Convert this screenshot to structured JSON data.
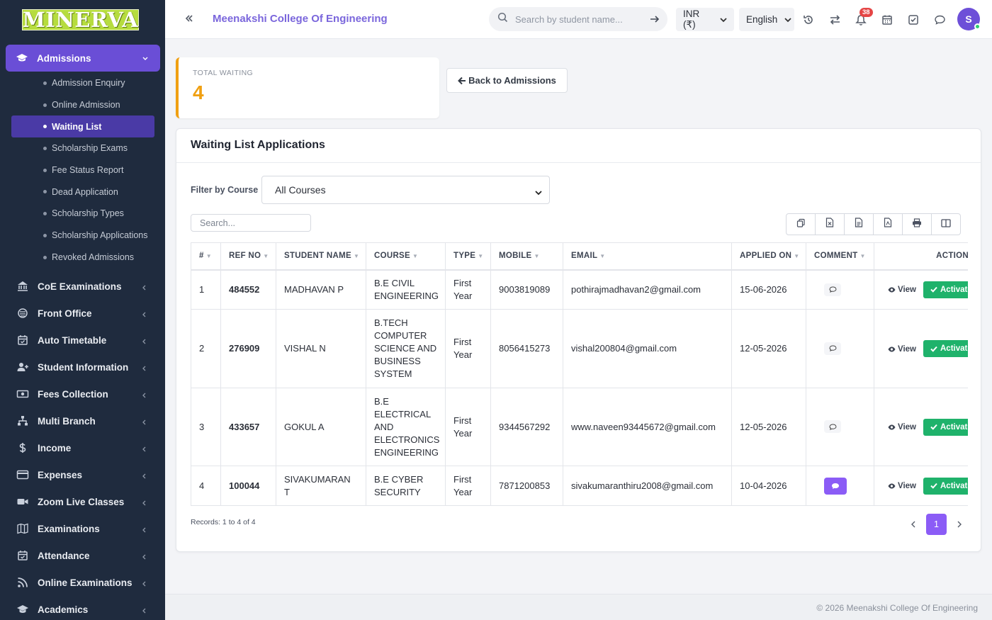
{
  "brand": {
    "logo_text": "MINERVA"
  },
  "sidebar": {
    "active_section": "Admissions",
    "admissions_items": [
      {
        "label": "Admission Enquiry"
      },
      {
        "label": "Online Admission"
      },
      {
        "label": "Waiting List",
        "active": true
      },
      {
        "label": "Scholarship Exams"
      },
      {
        "label": "Fee Status Report"
      },
      {
        "label": "Dead Application"
      },
      {
        "label": "Scholarship Types"
      },
      {
        "label": "Scholarship Applications"
      },
      {
        "label": "Revoked Admissions"
      }
    ],
    "sections": [
      {
        "label": "CoE Examinations",
        "icon": "bank-icon"
      },
      {
        "label": "Front Office",
        "icon": "front-office-icon"
      },
      {
        "label": "Auto Timetable",
        "icon": "calendar-check-icon"
      },
      {
        "label": "Student Information",
        "icon": "user-plus-icon"
      },
      {
        "label": "Fees Collection",
        "icon": "money-icon"
      },
      {
        "label": "Multi Branch",
        "icon": "sitemap-icon"
      },
      {
        "label": "Income",
        "icon": "dollar-icon"
      },
      {
        "label": "Expenses",
        "icon": "credit-card-icon"
      },
      {
        "label": "Zoom Live Classes",
        "icon": "video-icon"
      },
      {
        "label": "Examinations",
        "icon": "map-icon"
      },
      {
        "label": "Attendance",
        "icon": "calendar-check-icon"
      },
      {
        "label": "Online Examinations",
        "icon": "rss-icon"
      },
      {
        "label": "Academics",
        "icon": "graduation-cap-icon"
      }
    ]
  },
  "header": {
    "college_name": "Meenakshi College Of Engineering",
    "search_placeholder": "Search by student name...",
    "currency": "INR (₹)",
    "language": "English",
    "notification_count": "38",
    "avatar_initial": "S"
  },
  "stat": {
    "label": "TOTAL WAITING",
    "value": "4",
    "accent": "#f0a012"
  },
  "back_button": "Back to Admissions",
  "card": {
    "title": "Waiting List Applications",
    "filter_label": "Filter by Course",
    "filter_value": "All Courses",
    "search_placeholder": "Search...",
    "export_buttons": [
      "copy-icon",
      "excel-icon",
      "csv-icon",
      "pdf-icon",
      "print-icon",
      "columns-icon"
    ]
  },
  "table": {
    "columns": [
      "#",
      "REF NO",
      "STUDENT NAME",
      "COURSE",
      "TYPE",
      "MOBILE",
      "EMAIL",
      "APPLIED ON",
      "COMMENT",
      "ACTION"
    ],
    "rows": [
      {
        "no": "1",
        "ref": "484552",
        "name": "MADHAVAN P",
        "course": "B.E CIVIL ENGINEERING",
        "type": "First Year",
        "mobile": "9003819089",
        "email": "pothirajmadhavan2@gmail.com",
        "applied": "15-06-2026",
        "has_comment": false
      },
      {
        "no": "2",
        "ref": "276909",
        "name": "VISHAL N",
        "course": "B.TECH COMPUTER SCIENCE AND BUSINESS SYSTEM",
        "type": "First Year",
        "mobile": "8056415273",
        "email": "vishal200804@gmail.com",
        "applied": "12-05-2026",
        "has_comment": false
      },
      {
        "no": "3",
        "ref": "433657",
        "name": "GOKUL A",
        "course": "B.E ELECTRICAL AND ELECTRONICS ENGINEERING",
        "type": "First Year",
        "mobile": "9344567292",
        "email": "www.naveen93445672@gmail.com",
        "applied": "12-05-2026",
        "has_comment": false
      },
      {
        "no": "4",
        "ref": "100044",
        "name": "SIVAKUMARAN T",
        "course": "B.E CYBER SECURITY",
        "type": "First Year",
        "mobile": "7871200853",
        "email": "sivakumaranthiru2008@gmail.com",
        "applied": "10-04-2026",
        "has_comment": true
      }
    ],
    "view_label": "View",
    "activate_label": "Activate"
  },
  "footer_info": {
    "records": "Records: 1 to 4 of 4",
    "current_page": "1"
  },
  "footer": {
    "copyright": "© 2026 Meenakshi College Of Engineering"
  },
  "colors": {
    "primary": "#6a4ed6",
    "success": "#1fb26b",
    "sidebar": "#1f2b3e"
  }
}
